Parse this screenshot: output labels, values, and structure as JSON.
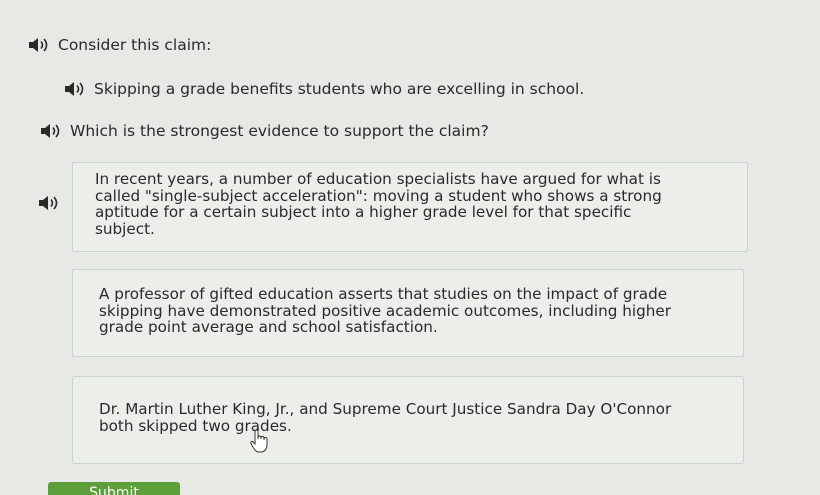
{
  "prompt": {
    "label": "Consider this claim:"
  },
  "claim": {
    "text": "Skipping a grade benefits students who are excelling in school."
  },
  "question": {
    "text": "Which is the strongest evidence to support the claim?"
  },
  "choices": [
    {
      "text": "In recent years, a number of education specialists have argued for what is\ncalled \"single-subject acceleration\": moving a student who shows a strong\naptitude for a certain subject into a higher grade level for that specific\nsubject."
    },
    {
      "text": "A professor of gifted education asserts that studies on the impact of grade\nskipping have demonstrated positive academic outcomes, including higher\ngrade point average and school satisfaction."
    },
    {
      "text": "Dr. Martin Luther King, Jr., and Supreme Court Justice Sandra Day O'Connor\nboth skipped two grades."
    }
  ],
  "submit": {
    "label": "Submit"
  },
  "icons": {
    "speaker": "speaker-icon",
    "cursor": "hand-pointer-icon"
  },
  "colors": {
    "accent": "#5c9e3a",
    "speaker": "#2a2a2a",
    "border": "#c9d3d3",
    "background": "#e6e9e4"
  }
}
